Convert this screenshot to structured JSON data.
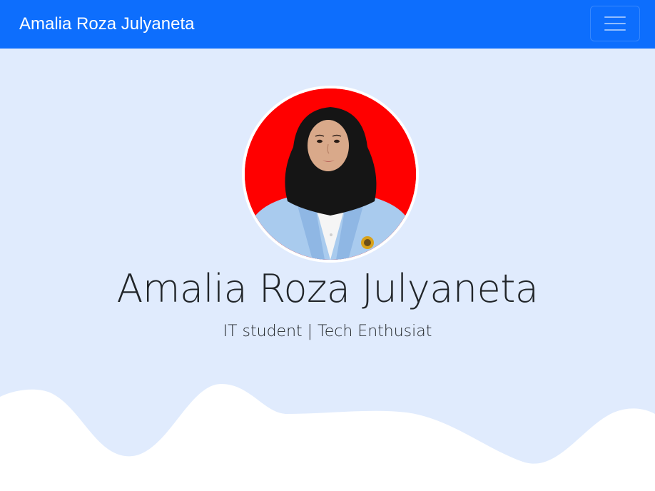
{
  "navbar": {
    "brand": "Amalia Roza Julyaneta",
    "toggler_icon": "hamburger-menu-icon"
  },
  "hero": {
    "name": "Amalia Roza Julyaneta",
    "tagline": "IT student | Tech Enthusiat",
    "avatar_icon": "profile-photo"
  },
  "colors": {
    "navbar_bg": "#0d6efd",
    "hero_bg": "#e0ebfd",
    "wave_fill": "#ffffff",
    "avatar_bg": "#ff0000"
  }
}
